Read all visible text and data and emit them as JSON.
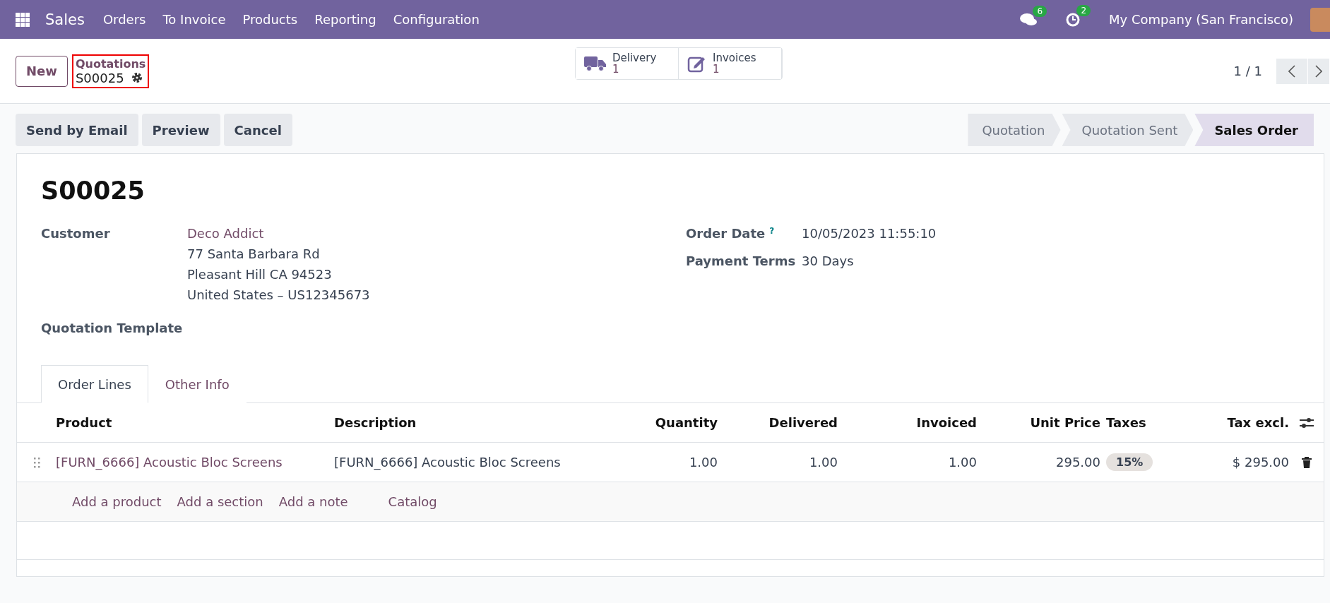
{
  "navbar": {
    "app": "Sales",
    "menus": [
      "Orders",
      "To Invoice",
      "Products",
      "Reporting",
      "Configuration"
    ],
    "messages_count": "6",
    "activities_count": "2",
    "company": "My Company (San Francisco)"
  },
  "control_panel": {
    "new_button": "New",
    "breadcrumb": "Quotations",
    "record": "S00025",
    "smart_buttons": [
      {
        "kind": "delivery",
        "label": "Delivery",
        "value": "1"
      },
      {
        "kind": "invoices",
        "label": "Invoices",
        "value": "1"
      }
    ],
    "pager": "1 / 1"
  },
  "actions": [
    "Send by Email",
    "Preview",
    "Cancel"
  ],
  "status_steps": [
    {
      "label": "Quotation",
      "selected": false
    },
    {
      "label": "Quotation Sent",
      "selected": false
    },
    {
      "label": "Sales Order",
      "selected": true
    }
  ],
  "form": {
    "title": "S00025",
    "left_fields": [
      {
        "label": "Customer",
        "value": "Deco Addict",
        "address": [
          "77 Santa Barbara Rd",
          "Pleasant Hill CA 94523",
          "United States – US12345673"
        ]
      },
      {
        "label": "Quotation Template"
      }
    ],
    "right_fields": [
      {
        "label": "Order Date",
        "help": "?",
        "value": "10/05/2023 11:55:10"
      },
      {
        "label": "Payment Terms",
        "value": "30 Days"
      }
    ]
  },
  "tabs": [
    {
      "label": "Order Lines",
      "selected": true
    },
    {
      "label": "Other Info",
      "selected": false
    }
  ],
  "table": {
    "columns": [
      "Product",
      "Description",
      "Quantity",
      "Delivered",
      "Invoiced",
      "Unit Price",
      "Taxes",
      "Tax excl."
    ],
    "rows": [
      {
        "product": "[FURN_6666] Acoustic Bloc Screens",
        "description": "[FURN_6666] Acoustic Bloc Screens",
        "quantity": "1.00",
        "delivered": "1.00",
        "invoiced": "1.00",
        "unit_price": "295.00",
        "taxes": "15%",
        "subtotal": "$ 295.00"
      }
    ],
    "add_links": [
      "Add a product",
      "Add a section",
      "Add a note",
      "Catalog"
    ]
  }
}
